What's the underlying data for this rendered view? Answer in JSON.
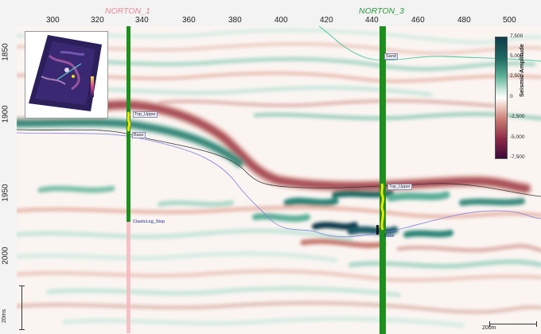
{
  "axis": {
    "x_ticks": [
      "300",
      "320",
      "340",
      "360",
      "380",
      "400",
      "420",
      "440",
      "460",
      "480",
      "500"
    ],
    "y_ticks": [
      "1850",
      "1900",
      "1950",
      "2000"
    ]
  },
  "wells": {
    "norton1": {
      "name": "NORTON_1",
      "color": "#e58a95"
    },
    "norton3": {
      "name": "NORTON_3",
      "color": "#2c9a3e"
    }
  },
  "horizon_labels": {
    "h1_w1": "Top_Upper",
    "h2_w1": "Base",
    "stop_w1": "ClasticLog_Stop",
    "h1_w3": "Top_Upper",
    "h2_w3": "Base",
    "green_w3": "Sand"
  },
  "colorbar": {
    "title": "Seismic Amplitude",
    "ticks": [
      "7,500",
      "5,000",
      "2,500",
      "0",
      "-2,500",
      "-5,000",
      "-7,500"
    ]
  },
  "scalebars": {
    "vertical": "20ms",
    "horizontal": "200m"
  },
  "colors": {
    "positive": "#1f6b63",
    "negative": "#8c2a47",
    "horizon_black": "#333333",
    "horizon_blue": "#7f7fe0",
    "horizon_green": "#3cc79a",
    "log_green": "#1e8f1e",
    "log_yellow": "#f2e600"
  }
}
